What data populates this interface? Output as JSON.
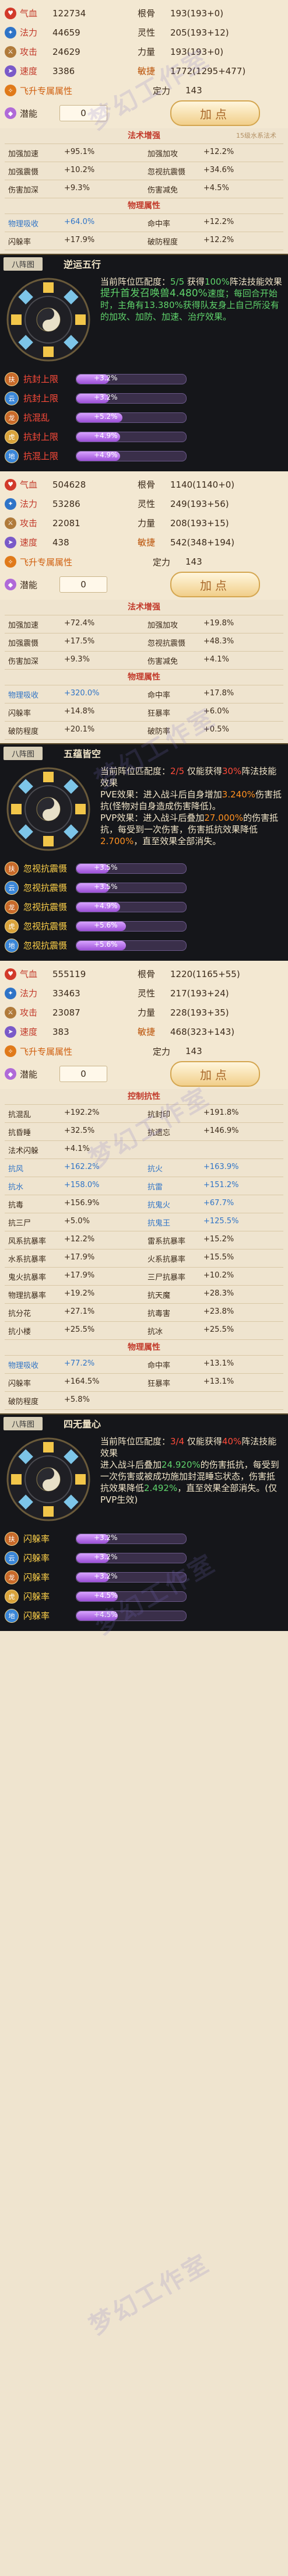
{
  "watermark": "梦幻工作室",
  "pets": [
    {
      "stats": [
        {
          "l": {
            "label": "气血",
            "val": "122734",
            "icon": "hp"
          },
          "r": {
            "label": "根骨",
            "val": "193(193+0)"
          }
        },
        {
          "l": {
            "label": "法力",
            "val": "44659",
            "icon": "mp"
          },
          "r": {
            "label": "灵性",
            "val": "205(193+12)"
          }
        },
        {
          "l": {
            "label": "攻击",
            "val": "24629",
            "icon": "atk"
          },
          "r": {
            "label": "力量",
            "val": "193(193+0)"
          }
        },
        {
          "l": {
            "label": "速度",
            "val": "3386",
            "icon": "spd"
          },
          "r": {
            "label": "敏捷",
            "val": "1772(1295+477)"
          }
        }
      ],
      "feisheng": {
        "label": "飞升专属属性",
        "r_label": "定力",
        "r_val": "143"
      },
      "qianneng": {
        "label": "潜能",
        "val": "0",
        "btn": "加点"
      },
      "fashu": {
        "title": "法术增强",
        "sub": "15级水系法术",
        "rows": [
          [
            [
              "加强加速",
              "+95.1%"
            ],
            [
              "加强加攻",
              "+12.2%"
            ]
          ],
          [
            [
              "加强震慑",
              "+10.2%"
            ],
            [
              "忽视抗震慑",
              "+34.6%"
            ]
          ],
          [
            [
              "伤害加深",
              "+9.3%"
            ],
            [
              "伤害减免",
              "+4.5%"
            ]
          ]
        ]
      },
      "wuli": {
        "title": "物理属性",
        "rows": [
          [
            [
              "物理吸收",
              "+64.0%",
              "blue"
            ],
            [
              "命中率",
              "+12.2%",
              ""
            ]
          ],
          [
            [
              "闪躲率",
              "+17.9%",
              ""
            ],
            [
              "破防程度",
              "+12.2%",
              ""
            ]
          ]
        ]
      },
      "formation": {
        "tag": "八阵图",
        "name": "逆运五行",
        "text": [
          {
            "t": "当前阵位匹配度：",
            "c": ""
          },
          {
            "t": "5/5",
            "c": "g"
          },
          {
            "t": " 获得",
            "c": ""
          },
          {
            "t": "100%",
            "c": "g"
          },
          {
            "t": "阵法技能效果",
            "c": ""
          },
          {
            "br": true
          },
          {
            "t": "提升首发召唤兽",
            "c": "g big"
          },
          {
            "t": "4.480%",
            "c": "g big"
          },
          {
            "t": "速度；每回合开始时，主角有",
            "c": "g"
          },
          {
            "t": "13.380%",
            "c": "g"
          },
          {
            "t": "获得队友身上自己所没有的加攻、加防、加速、治疗效果。",
            "c": "g"
          }
        ],
        "bars": [
          {
            "dot": "扶",
            "label": "抗封上限",
            "val": "+3.2%",
            "pct": 0.3,
            "dc": "#c86a2a",
            "gold": false
          },
          {
            "dot": "云",
            "label": "抗封上限",
            "val": "+3.2%",
            "pct": 0.3,
            "dc": "#3a86d8",
            "gold": false
          },
          {
            "dot": "龙",
            "label": "抗混乱",
            "val": "+5.2%",
            "pct": 0.42,
            "dc": "#c86a2a",
            "gold": false
          },
          {
            "dot": "虎",
            "label": "抗封上限",
            "val": "+4.9%",
            "pct": 0.4,
            "dc": "#d9a23a",
            "gold": false
          },
          {
            "dot": "地",
            "label": "抗混上限",
            "val": "+4.9%",
            "pct": 0.4,
            "dc": "#3a86d8",
            "gold": false
          }
        ]
      }
    },
    {
      "stats": [
        {
          "l": {
            "label": "气血",
            "val": "504628",
            "icon": "hp"
          },
          "r": {
            "label": "根骨",
            "val": "1140(1140+0)"
          }
        },
        {
          "l": {
            "label": "法力",
            "val": "53286",
            "icon": "mp"
          },
          "r": {
            "label": "灵性",
            "val": "249(193+56)"
          }
        },
        {
          "l": {
            "label": "攻击",
            "val": "22081",
            "icon": "atk"
          },
          "r": {
            "label": "力量",
            "val": "208(193+15)"
          }
        },
        {
          "l": {
            "label": "速度",
            "val": "438",
            "icon": "spd"
          },
          "r": {
            "label": "敏捷",
            "val": "542(348+194)"
          }
        }
      ],
      "feisheng": {
        "label": "飞升专属属性",
        "r_label": "定力",
        "r_val": "143"
      },
      "qianneng": {
        "label": "潜能",
        "val": "0",
        "btn": "加点"
      },
      "fashu": {
        "title": "法术增强",
        "sub": "",
        "rows": [
          [
            [
              "加强加速",
              "+72.4%"
            ],
            [
              "加强加攻",
              "+19.8%"
            ]
          ],
          [
            [
              "加强震慑",
              "+17.5%"
            ],
            [
              "忽视抗震慑",
              "+48.3%"
            ]
          ],
          [
            [
              "伤害加深",
              "+9.3%"
            ],
            [
              "伤害减免",
              "+4.1%"
            ]
          ]
        ]
      },
      "wuli": {
        "title": "物理属性",
        "rows": [
          [
            [
              "物理吸收",
              "+320.0%",
              "blue"
            ],
            [
              "命中率",
              "+17.8%",
              ""
            ]
          ],
          [
            [
              "闪躲率",
              "+14.8%",
              ""
            ],
            [
              "狂暴率",
              "+6.0%",
              ""
            ]
          ],
          [
            [
              "破防程度",
              "+20.1%",
              ""
            ],
            [
              "破防率",
              "+0.5%",
              ""
            ]
          ]
        ]
      },
      "formation": {
        "tag": "八阵图",
        "name": "五蕴皆空",
        "text": [
          {
            "t": "当前阵位匹配度：",
            "c": ""
          },
          {
            "t": "2/5",
            "c": "r"
          },
          {
            "t": " 仅能获得",
            "c": ""
          },
          {
            "t": "30%",
            "c": "r"
          },
          {
            "t": "阵法技能效果",
            "c": ""
          },
          {
            "br": true
          },
          {
            "t": "PVE效果：进入战斗后自身增加",
            "c": ""
          },
          {
            "t": "3.240%",
            "c": "o"
          },
          {
            "t": "伤害抵抗(怪物对自身造成伤害降低)。",
            "c": ""
          },
          {
            "br": true
          },
          {
            "t": "PVP效果：进入战斗后叠加",
            "c": ""
          },
          {
            "t": "27.000%",
            "c": "o"
          },
          {
            "t": "的伤害抵抗，每受到一次伤害，伤害抵抗效果降低",
            "c": ""
          },
          {
            "t": "2.700%",
            "c": "o"
          },
          {
            "t": "，直至效果全部消失。",
            "c": ""
          }
        ],
        "bars": [
          {
            "dot": "扶",
            "label": "忽视抗震慑",
            "val": "+3.5%",
            "pct": 0.3,
            "dc": "#c86a2a",
            "gold": true
          },
          {
            "dot": "云",
            "label": "忽视抗震慑",
            "val": "+3.5%",
            "pct": 0.3,
            "dc": "#3a86d8",
            "gold": true
          },
          {
            "dot": "龙",
            "label": "忽视抗震慑",
            "val": "+4.9%",
            "pct": 0.4,
            "dc": "#c86a2a",
            "gold": true
          },
          {
            "dot": "虎",
            "label": "忽视抗震慑",
            "val": "+5.6%",
            "pct": 0.45,
            "dc": "#d9a23a",
            "gold": true
          },
          {
            "dot": "地",
            "label": "忽视抗震慑",
            "val": "+5.6%",
            "pct": 0.45,
            "dc": "#3a86d8",
            "gold": true
          }
        ]
      }
    },
    {
      "stats": [
        {
          "l": {
            "label": "气血",
            "val": "555119",
            "icon": "hp"
          },
          "r": {
            "label": "根骨",
            "val": "1220(1165+55)"
          }
        },
        {
          "l": {
            "label": "法力",
            "val": "33463",
            "icon": "mp"
          },
          "r": {
            "label": "灵性",
            "val": "217(193+24)"
          }
        },
        {
          "l": {
            "label": "攻击",
            "val": "23087",
            "icon": "atk"
          },
          "r": {
            "label": "力量",
            "val": "228(193+35)"
          }
        },
        {
          "l": {
            "label": "速度",
            "val": "383",
            "icon": "spd"
          },
          "r": {
            "label": "敏捷",
            "val": "468(323+143)"
          }
        }
      ],
      "feisheng": {
        "label": "飞升专属属性",
        "r_label": "定力",
        "r_val": "143"
      },
      "qianneng": {
        "label": "潜能",
        "val": "0",
        "btn": "加点"
      },
      "kongzhi": {
        "title": "控制抗性",
        "rows": [
          [
            [
              "抗混乱",
              "+192.2%",
              ""
            ],
            [
              "抗封印",
              "+191.8%",
              ""
            ]
          ],
          [
            [
              "抗昏睡",
              "+32.5%",
              ""
            ],
            [
              "抗遗忘",
              "+146.9%",
              ""
            ]
          ],
          [
            [
              "法术闪躲",
              "+4.1%",
              ""
            ],
            [
              "",
              "",
              " "
            ]
          ],
          [
            [
              "抗风",
              "+162.2%",
              "blue"
            ],
            [
              "抗火",
              "+163.9%",
              "blue"
            ]
          ],
          [
            [
              "抗水",
              "+158.0%",
              "blue"
            ],
            [
              "抗雷",
              "+151.2%",
              "blue"
            ]
          ],
          [
            [
              "抗毒",
              "+156.9%",
              ""
            ],
            [
              "抗鬼火",
              "+67.7%",
              "blue"
            ]
          ],
          [
            [
              "抗三尸",
              "+5.0%",
              ""
            ],
            [
              "抗鬼王",
              "+125.5%",
              "blue"
            ]
          ],
          [
            [
              "风系抗暴率",
              "+12.2%",
              ""
            ],
            [
              "雷系抗暴率",
              "+15.2%",
              ""
            ]
          ],
          [
            [
              "水系抗暴率",
              "+17.9%",
              ""
            ],
            [
              "火系抗暴率",
              "+15.5%",
              ""
            ]
          ],
          [
            [
              "鬼火抗暴率",
              "+17.9%",
              ""
            ],
            [
              "三尸抗暴率",
              "+10.2%",
              ""
            ]
          ],
          [
            [
              "物理抗暴率",
              "+19.2%",
              ""
            ],
            [
              "抗天魔",
              "+28.3%",
              ""
            ]
          ],
          [
            [
              "抗分花",
              "+27.1%",
              ""
            ],
            [
              "抗毒害",
              "+23.8%",
              ""
            ]
          ],
          [
            [
              "抗小楼",
              "+25.5%",
              ""
            ],
            [
              "抗冰",
              "+25.5%",
              ""
            ]
          ]
        ]
      },
      "wuli": {
        "title": "物理属性",
        "rows": [
          [
            [
              "物理吸收",
              "+77.2%",
              "blue"
            ],
            [
              "命中率",
              "+13.1%",
              ""
            ]
          ],
          [
            [
              "闪躲率",
              "+164.5%",
              ""
            ],
            [
              "狂暴率",
              "+13.1%",
              ""
            ]
          ],
          [
            [
              "破防程度",
              "+5.8%",
              ""
            ],
            [
              "",
              "",
              " "
            ]
          ]
        ]
      },
      "formation": {
        "tag": "八阵图",
        "name": "四无量心",
        "text": [
          {
            "t": "当前阵位匹配度：",
            "c": ""
          },
          {
            "t": "3/4",
            "c": "r"
          },
          {
            "t": " 仅能获得",
            "c": ""
          },
          {
            "t": "40%",
            "c": "r"
          },
          {
            "t": "阵法技能效果",
            "c": ""
          },
          {
            "br": true
          },
          {
            "t": "进入战斗后叠加",
            "c": ""
          },
          {
            "t": "24.920%",
            "c": "g"
          },
          {
            "t": "的伤害抵抗，每受到一次伤害或被成功施加封混睡忘状态，伤害抵抗效果降低",
            "c": ""
          },
          {
            "t": "2.492%",
            "c": "g"
          },
          {
            "t": "，直至效果全部消失。(仅PVP生效)",
            "c": ""
          }
        ],
        "bars": [
          {
            "dot": "扶",
            "label": "闪躲率",
            "val": "+3.2%",
            "pct": 0.3,
            "dc": "#c86a2a",
            "gold": true
          },
          {
            "dot": "云",
            "label": "闪躲率",
            "val": "+3.2%",
            "pct": 0.3,
            "dc": "#3a86d8",
            "gold": true
          },
          {
            "dot": "龙",
            "label": "闪躲率",
            "val": "+3.2%",
            "pct": 0.3,
            "dc": "#c86a2a",
            "gold": true
          },
          {
            "dot": "虎",
            "label": "闪躲率",
            "val": "+4.5%",
            "pct": 0.38,
            "dc": "#d9a23a",
            "gold": true
          },
          {
            "dot": "地",
            "label": "闪躲率",
            "val": "+4.5%",
            "pct": 0.38,
            "dc": "#3a86d8",
            "gold": true
          }
        ]
      }
    }
  ]
}
